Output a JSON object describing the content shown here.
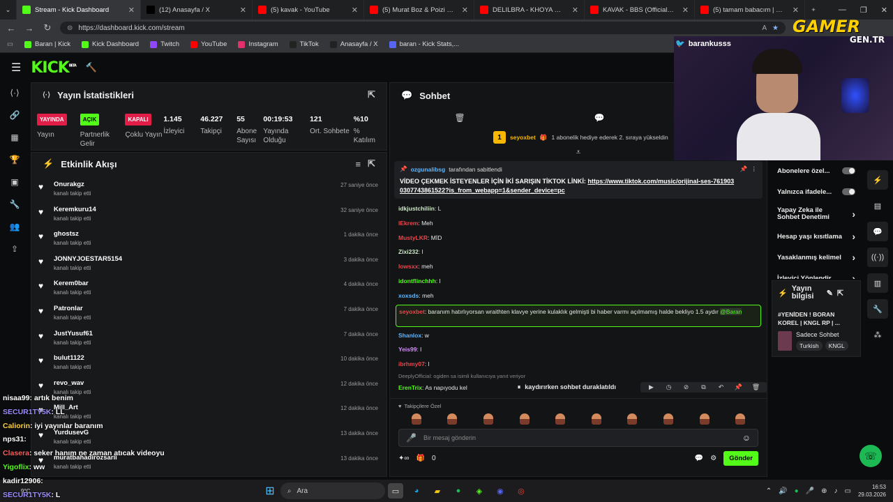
{
  "browser": {
    "tabs": [
      {
        "title": "Stream - Kick Dashboard",
        "color": "#53fc18",
        "active": true
      },
      {
        "title": "(12) Anasayfa / X",
        "color": "#000000"
      },
      {
        "title": "(5) kavak - YouTube",
        "color": "#ff0000"
      },
      {
        "title": "(5) Murat Boz & Poizi | Özledim | R",
        "color": "#ff0000"
      },
      {
        "title": "DELILBRA - KHOYA SHOOT (PROD",
        "color": "#ff0000"
      },
      {
        "title": "KAVAK - BBS (Official Video) - You",
        "color": "#ff0000"
      },
      {
        "title": "(5) tamam babacım | KNGLRP | Yo",
        "color": "#ff0000"
      }
    ],
    "url": "https://dashboard.kick.com/stream",
    "bookmarks": [
      {
        "label": "Baran | Kick",
        "color": "#53fc18"
      },
      {
        "label": "Kick Dashboard",
        "color": "#53fc18"
      },
      {
        "label": "Twitch",
        "color": "#9146ff"
      },
      {
        "label": "YouTube",
        "color": "#ff0000"
      },
      {
        "label": "Instagram",
        "color": "#e1306c"
      },
      {
        "label": "TikTok",
        "color": "#222222"
      },
      {
        "label": "Anasayfa / X",
        "color": "#222222"
      },
      {
        "label": "baran - Kick Stats,...",
        "color": "#5865f2"
      }
    ]
  },
  "overlay": {
    "watermark": "GAMER",
    "watermark_sub": "GEN.TR",
    "twitter_handle": "barankusss"
  },
  "kick": {
    "logo": "KICK",
    "logo_beta": "BETA"
  },
  "stats": {
    "title": "Yayın İstatistikleri",
    "items": [
      {
        "badge": "YAYINDA",
        "badge_color": "#e11d48",
        "label": "Yayın"
      },
      {
        "badge": "AÇIK",
        "badge_color": "#53fc18",
        "label": "Partnerlik Gelir"
      },
      {
        "badge": "KAPALI",
        "badge_color": "#e11d48",
        "label": "Çoklu Yayın"
      },
      {
        "value": "1.145",
        "label": "İzleyici"
      },
      {
        "value": "46.227",
        "label": "Takipçi"
      },
      {
        "value": "55",
        "label": "Abone Sayısı"
      },
      {
        "value": "00:19:53",
        "label": "Yayında Olduğu"
      },
      {
        "value": "121",
        "label": "Ort. Sohbete"
      },
      {
        "value": "%10",
        "label": "% Katılım"
      }
    ]
  },
  "activity": {
    "title": "Etkinlik Akışı",
    "items": [
      {
        "name": "Onurakgz",
        "sub": "kanalı takip etti",
        "time": "27 saniye önce"
      },
      {
        "name": "Keremkuru14",
        "sub": "kanalı takip etti",
        "time": "32 saniye önce"
      },
      {
        "name": "ghostsz",
        "sub": "kanalı takip etti",
        "time": "1 dakika önce"
      },
      {
        "name": "JONNYJOESTAR5154",
        "sub": "kanalı takip etti",
        "time": "3 dakika önce"
      },
      {
        "name": "Kerem0bar",
        "sub": "kanalı takip etti",
        "time": "4 dakika önce"
      },
      {
        "name": "Patronlar",
        "sub": "kanalı takip etti",
        "time": "7 dakika önce"
      },
      {
        "name": "JustYusuf61",
        "sub": "kanalı takip etti",
        "time": "7 dakika önce"
      },
      {
        "name": "bulut1122",
        "sub": "kanalı takip etti",
        "time": "10 dakika önce"
      },
      {
        "name": "revo_wav",
        "sub": "kanalı takip etti",
        "time": "12 dakika önce"
      },
      {
        "name": "Mill_Art",
        "sub": "kanalı takip etti",
        "time": "12 dakika önce"
      },
      {
        "name": "YurdusevG",
        "sub": "kanalı takip etti",
        "time": "13 dakika önce"
      },
      {
        "name": "muratbahadirozsarii",
        "sub": "kanalı takip etti",
        "time": "13 dakika önce"
      }
    ]
  },
  "overlay_chat": [
    {
      "user": "nisaa99",
      "msg": ": artık benim",
      "color": "#ffffff"
    },
    {
      "user": "SECUR1TY5K",
      "msg": ": LL",
      "color": "#9b8cff"
    },
    {
      "user": "Caliorin",
      "msg": ": iyi yayınlar baranım",
      "color": "#ffd23c"
    },
    {
      "user": "nps31",
      "msg": ":",
      "color": "#ffffff"
    },
    {
      "user": "Clasera",
      "msg": ": seker hanım ne zaman atıcak videoyu",
      "color": "#ff5c5c"
    },
    {
      "user": "Yigoflix",
      "msg": ": ww",
      "color": "#53fc18"
    },
    {
      "user": "kadir12906",
      "msg": ":",
      "color": "#ffffff"
    },
    {
      "user": "SECUR1TY5K",
      "msg": ": L",
      "color": "#9b8cff"
    }
  ],
  "chat": {
    "title": "Sohbet",
    "sub_event_user": "seyoxbet",
    "sub_event_text": "1 abonelik hediye ederek 2. sıraya yükseldin",
    "sub_event_rank": "1",
    "pinned_by": "ozgunalibsg",
    "pinned_suffix": "tarafından sabitlendi",
    "pinned_text": "VİDEO ÇEKMEK İSTEYENLER İÇİN İKİ SARIŞIN TİKTOK LİNKİ:",
    "pinned_link": "https://www.tiktok.com/music/orijinal-ses-7619030307743861522?is_from_webapp=1&sender_device=pc",
    "messages": [
      {
        "user": "idkjustchiliin",
        "text": ": L",
        "color": "#cfe8c8"
      },
      {
        "user": "lEkrem",
        "text": ": Meh",
        "color": "#e5484d"
      },
      {
        "user": "MustyLKR",
        "text": ": MİD",
        "color": "#e5484d"
      },
      {
        "user": "Zixi232",
        "text": ": l",
        "color": "#cfe8c8"
      },
      {
        "user": "lowsxx",
        "text": ": meh",
        "color": "#e5484d"
      },
      {
        "user": "idontflinchhh",
        "text": ": l",
        "color": "#53fc18"
      },
      {
        "user": "xoxsds",
        "text": ": meh",
        "color": "#5eb7ff"
      }
    ],
    "highlight_user": "seyoxbet",
    "highlight_text": ": baranım hatırlıyorsan wraithten klavye yerine kulaklık gelmişti bi haber varmı açılmamış halde bekliyo 1.5 aydır",
    "highlight_mention": "@Baran",
    "messages2": [
      {
        "user": "Shanlox",
        "text": ": w",
        "color": "#5eb7ff"
      },
      {
        "user": "Yeis99",
        "text": ": l",
        "color": "#d78cff"
      },
      {
        "user": "ibrhmy07",
        "text": ": l",
        "color": "#e5484d"
      }
    ],
    "reply_text": "DeeplyOfficial: ogiden sa isimli kullanıcıya yanıt veriyor",
    "last_user": "ErenTrix",
    "last_text": ": As napıyodu kel",
    "paused": "kaydırırken sohbet duraklatıldı",
    "follower_only": "Takipçilere Özel",
    "input_placeholder": "Bir mesaj gönderin",
    "count": "0",
    "send_label": "Gönder"
  },
  "right_panel": {
    "items": [
      {
        "label": "Abonelere özel...",
        "toggle": true
      },
      {
        "label": "Yalnızca ifadele...",
        "toggle": true
      },
      {
        "label": "Yapay Zeka ile Sohbet Denetimi"
      },
      {
        "label": "Hesap yaşı kısıtlama"
      },
      {
        "label": "Yasaklanmış kelimel"
      },
      {
        "label": "İzleyici Yönlendir"
      }
    ],
    "stream_info_title": "Yayın bilgisi",
    "stream_title": "#YENİDEN ! BORAN KOREL | KNGL RP | ...",
    "category": "Sadece Sohbet",
    "tags": [
      "Turkish",
      "KNGL"
    ]
  },
  "taskbar": {
    "search": "Ara",
    "time": "16:53",
    "date": "29.03.2026",
    "weather": "9°C"
  }
}
